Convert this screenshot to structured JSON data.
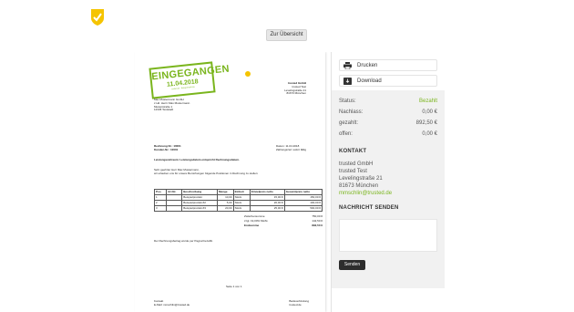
{
  "header": {
    "back_label": "Zur Übersicht"
  },
  "document": {
    "stamp": {
      "title": "EINGEGANGEN",
      "date": "11.04.2018",
      "foot": "trusted.de · Belegverwaltung"
    },
    "sender": [
      "trusted GmbH",
      "trusted Test",
      "Levelingstraße 21",
      "81673 München"
    ],
    "recipient": [
      "Max Mustermann GmbH",
      "z.Hd. Herrn Max Mustermann",
      "Musterstraße 1",
      "12345 Teststadt"
    ],
    "invoice_no": "Rechnung Nr.: 10001",
    "customer_no": "Kunden-Nr.: 10001",
    "date": "Datum: 11.04.2018",
    "terms": "Zahlungsziel: sofort fällig",
    "period_note": "Leistungszeitraum: Leistungsdatum entspricht Rechnungsdatum.",
    "greeting": "Sehr geehrter Herr Max Mustermann,",
    "intro": "wir erlauben uns für unsere Bemühungen folgende Positionen in Rechnung zu stellen:",
    "table": {
      "headers": [
        "Pos.",
        "Art.Nr.",
        "Beschreibung",
        "Menge",
        "Einheit",
        "Einzelpreis netto",
        "Gesamtpreis netto"
      ],
      "rows": [
        [
          "1",
          "",
          "Beispielprodukt",
          "10,00",
          "Stück",
          "15,00 €",
          "150,00 €"
        ],
        [
          "2",
          "",
          "Beispielprodukt #2",
          "5,00",
          "Stück",
          "20,00 €",
          "100,00 €"
        ],
        [
          "3",
          "",
          "Beispielprodukt #3",
          "20,00",
          "Stück",
          "25,00 €",
          "500,00 €"
        ]
      ]
    },
    "sums": [
      {
        "label": "Zwischensumme",
        "value": "750,00 €"
      },
      {
        "label": "zzgl. 19,00% MwSt.",
        "value": "142,50 €"
      },
      {
        "label": "Endsumme",
        "value": "892,50 €"
      }
    ],
    "payment_note": "Der Rechnungsbetrag wurde per Paypal bezahlt.",
    "page": "Seite 1 von 1",
    "footer": {
      "left": [
        "Kontakt",
        "E-Mail: mmschlin@trusted.de"
      ],
      "right": [
        "Bankverbindung",
        "trusted.de"
      ]
    }
  },
  "actions": {
    "print_label": "Drucken",
    "download_label": "Download"
  },
  "status": [
    {
      "label": "Status:",
      "value": "Bezahlt"
    },
    {
      "label": "Nachlass:",
      "value": "0,00 €"
    },
    {
      "label": "gezahlt:",
      "value": "892,50 €"
    },
    {
      "label": "offen:",
      "value": "0,00 €"
    }
  ],
  "contact": {
    "title": "KONTAKT",
    "lines": [
      "trusted GmbH",
      "trusted Test",
      "Levelingstraße 21",
      "81673 München"
    ],
    "email": "mmschlin@trusted.de"
  },
  "message": {
    "title": "NACHRICHT SENDEN",
    "placeholder": "",
    "send_label": "Senden"
  },
  "colors": {
    "accent": "#7ab51d",
    "logo": "#f5c400",
    "sidebar_bg": "#f1f1f1",
    "send_bg": "#2d2d2d"
  }
}
